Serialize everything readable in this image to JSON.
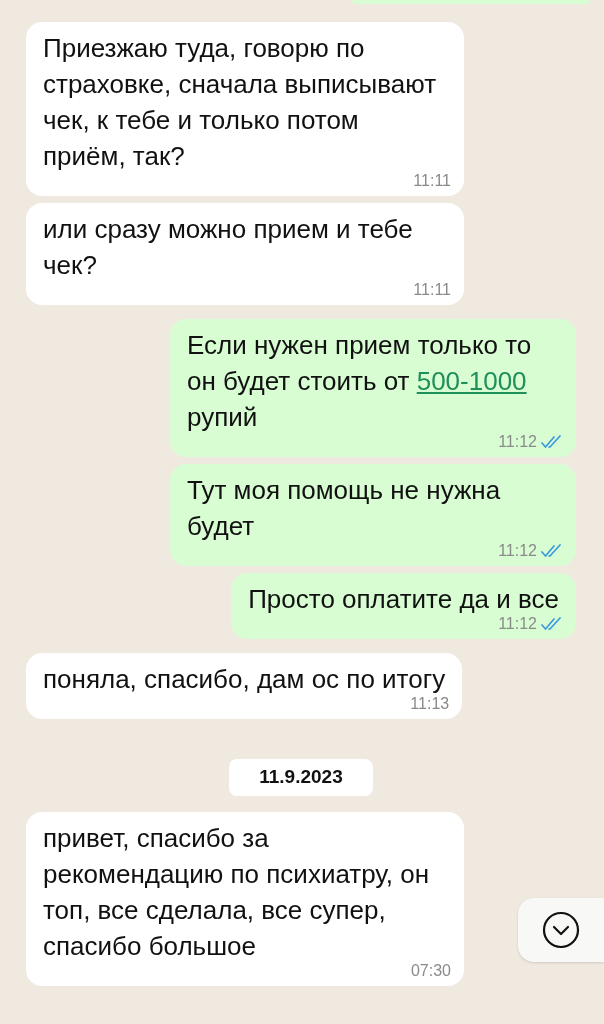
{
  "messages": [
    {
      "kind": "incoming",
      "parts": [
        {
          "kind": "text",
          "text": "Приезжаю туда, говорю по страховке, сначала выписывают чек, к тебе и только потом приём, так?"
        }
      ],
      "time": "11:11"
    },
    {
      "kind": "incoming",
      "parts": [
        {
          "kind": "text",
          "text": "или сразу можно прием и тебе чек?"
        }
      ],
      "time": "11:11"
    },
    {
      "kind": "outgoing",
      "parts": [
        {
          "kind": "text",
          "text": "Если нужен прием только то он будет стоить от "
        },
        {
          "kind": "link",
          "text": "500-1000"
        },
        {
          "kind": "text",
          "text": " рупий"
        }
      ],
      "time": "11:12",
      "read": true
    },
    {
      "kind": "outgoing",
      "parts": [
        {
          "kind": "text",
          "text": "Тут моя помощь не нужна будет"
        }
      ],
      "time": "11:12",
      "read": true
    },
    {
      "kind": "outgoing",
      "parts": [
        {
          "kind": "text",
          "text": "Просто оплатите да и все"
        }
      ],
      "time": "11:12",
      "read": true
    },
    {
      "kind": "incoming",
      "parts": [
        {
          "kind": "text",
          "text": "поняла, спасибо, дам ос по итогу"
        }
      ],
      "time": "11:13"
    },
    {
      "kind": "date",
      "text": "11.9.2023"
    },
    {
      "kind": "incoming",
      "parts": [
        {
          "kind": "text",
          "text": "привет, спасибо за рекомендацию по психиатру, он топ, все сделала, все супер, спасибо большое"
        }
      ],
      "time": "07:30"
    }
  ]
}
